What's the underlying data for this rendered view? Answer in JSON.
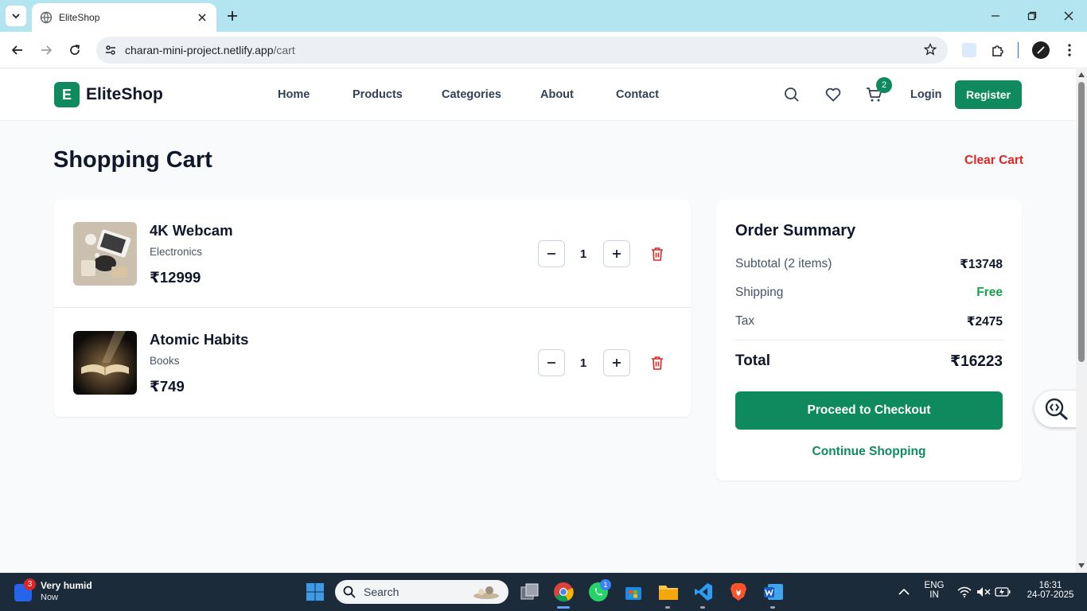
{
  "browser": {
    "tab_title": "EliteShop",
    "url_host": "charan-mini-project.netlify.app",
    "url_path": "/cart"
  },
  "site": {
    "logo_letter": "E",
    "logo_text": "EliteShop",
    "nav": [
      "Home",
      "Products",
      "Categories",
      "About",
      "Contact"
    ],
    "cart_count": "2",
    "login_label": "Login",
    "register_label": "Register"
  },
  "page": {
    "title": "Shopping Cart",
    "clear_cart_label": "Clear Cart"
  },
  "cart_items": [
    {
      "name": "4K Webcam",
      "category": "Electronics",
      "price": "₹12999",
      "quantity": "1"
    },
    {
      "name": "Atomic Habits",
      "category": "Books",
      "price": "₹749",
      "quantity": "1"
    }
  ],
  "summary": {
    "title": "Order Summary",
    "subtotal_label": "Subtotal (2 items)",
    "subtotal_value": "₹13748",
    "shipping_label": "Shipping",
    "shipping_value": "Free",
    "tax_label": "Tax",
    "tax_value": "₹2475",
    "total_label": "Total",
    "total_value": "₹16223",
    "checkout_label": "Proceed to Checkout",
    "continue_label": "Continue Shopping"
  },
  "taskbar": {
    "weather_title": "Very humid",
    "weather_sub": "Now",
    "weather_badge": "3",
    "search_label": "Search",
    "whatsapp_badge": "1",
    "lang_top": "ENG",
    "lang_bottom": "IN",
    "time": "16:31",
    "date": "24-07-2025"
  },
  "colors": {
    "brand": "#0f8a5f",
    "danger": "#dc2626",
    "free_green": "#16a34a",
    "page_bg": "#f8fafc",
    "tabstrip": "#b3e5f0",
    "taskbar": "#1c2b3a"
  }
}
